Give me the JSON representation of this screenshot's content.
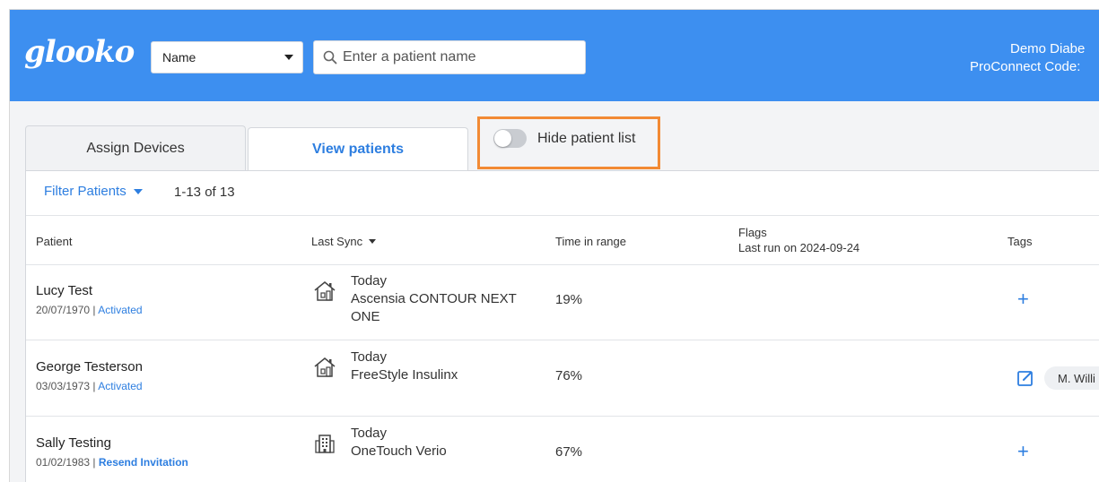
{
  "header": {
    "logo": "glooko",
    "search_type": "Name",
    "search_placeholder": "Enter a patient name",
    "account_line1": "Demo Diabe",
    "account_line2": "ProConnect Code:",
    "bg_color": "#3d8ff0"
  },
  "tabs": {
    "assign_devices": "Assign Devices",
    "view_patients": "View patients",
    "hide_patient_list": "Hide patient list",
    "hide_patient_list_on": false
  },
  "filter": {
    "label": "Filter Patients",
    "count": "1-13 of 13"
  },
  "columns": {
    "patient": "Patient",
    "last_sync": "Last Sync",
    "time_in_range": "Time in range",
    "flags": "Flags",
    "flags_sub": "Last run on 2024-09-24",
    "tags": "Tags"
  },
  "patients": [
    {
      "name": "Lucy Test",
      "dob": "20/07/1970",
      "status": "Activated",
      "sync_when": "Today",
      "device": "Ascensia CONTOUR NEXT ONE",
      "sync_icon": "home-icon",
      "tir": "19%",
      "tag": ""
    },
    {
      "name": "George Testerson",
      "dob": "03/03/1973",
      "status": "Activated",
      "sync_when": "Today",
      "device": "FreeStyle Insulinx",
      "sync_icon": "home-icon",
      "tir": "76%",
      "tag": "M. Willi"
    },
    {
      "name": "Sally Testing",
      "dob": "01/02/1983",
      "status": "Resend Invitation",
      "sync_when": "Today",
      "device": "OneTouch Verio",
      "sync_icon": "clinic-building-icon",
      "tir": "67%",
      "tag": ""
    }
  ],
  "icons": {
    "search": "search-icon",
    "dropdown": "chevron-down-icon",
    "toggle": "toggle-switch",
    "add_tag": "plus-icon",
    "edit_tag": "edit-icon"
  },
  "colors": {
    "accent": "#2d7ee0",
    "highlight_box": "#f28a34"
  },
  "sep": " | "
}
